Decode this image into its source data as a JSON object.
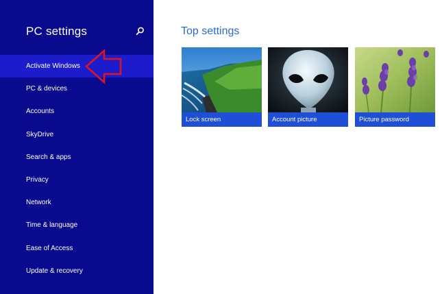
{
  "sidebar": {
    "title": "PC settings",
    "search_icon": "search-icon",
    "items": [
      {
        "label": "Activate Windows",
        "selected": true
      },
      {
        "label": "PC & devices"
      },
      {
        "label": "Accounts"
      },
      {
        "label": "SkyDrive"
      },
      {
        "label": "Search & apps"
      },
      {
        "label": "Privacy"
      },
      {
        "label": "Network"
      },
      {
        "label": "Time & language"
      },
      {
        "label": "Ease of Access"
      },
      {
        "label": "Update & recovery"
      }
    ]
  },
  "main": {
    "title": "Top settings",
    "tiles": [
      {
        "label": "Lock screen",
        "image": "coastline-image"
      },
      {
        "label": "Account picture",
        "image": "alien-image"
      },
      {
        "label": "Picture password",
        "image": "lavender-image"
      }
    ]
  },
  "colors": {
    "sidebar_bg": "#0a0a8f",
    "selected_bg": "#1c1ccc",
    "accent": "#2a6ad8",
    "tile_label_bg": "#1e4fd6",
    "annotation": "#e0141e"
  }
}
